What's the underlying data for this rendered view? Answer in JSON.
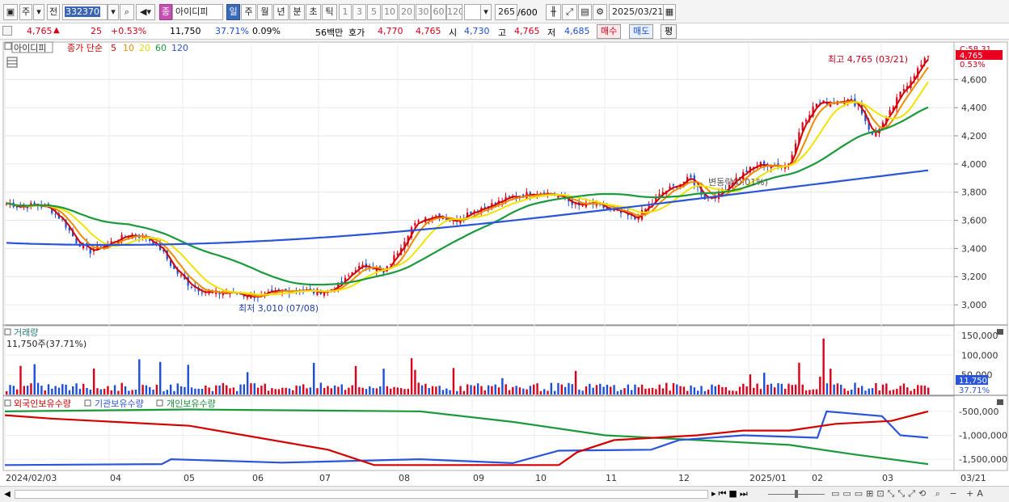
{
  "toolbar": {
    "type_label": "주",
    "prev_label": "전",
    "stock_code": "332370",
    "indicator_label": "종",
    "stock_name": "아이디피",
    "period_day": "일",
    "period_week": "주",
    "period_month": "월",
    "period_year": "년",
    "period_minute": "분",
    "period_second": "초",
    "period_tick": "틱",
    "intervals": [
      "1",
      "3",
      "5",
      "10",
      "20",
      "30",
      "60",
      "120"
    ],
    "count_value": "265",
    "count_total": "/600",
    "date": "2025/03/21"
  },
  "quote": {
    "price": "4,765",
    "change_arrow": "▲",
    "change": "25",
    "change_pct": "+0.53%",
    "volume": "11,750",
    "volume_ratio": "37.71%",
    "turnover": "0.09%",
    "amount": "56백만",
    "bid_label": "호가",
    "bid_1": "4,770",
    "bid_2": "4,765",
    "open_label": "시",
    "open": "4,730",
    "high_label": "고",
    "high": "4,765",
    "low_label": "저",
    "low": "4,685",
    "buy_label": "매수",
    "sell_label": "매도",
    "eval_label": "평"
  },
  "chart_legend": {
    "name_tag": "아이디피",
    "series_label": "종가 단순",
    "ma": [
      "5",
      "10",
      "20",
      "60",
      "120"
    ]
  },
  "annotations": {
    "high_note": "최고 4,765 (03/21)",
    "low_note": "최저 3,010 (07/08)",
    "mid_note": "변동락(0.01%)",
    "price_box": "4,765",
    "price_pct": "0.53%",
    "c_label": "C:58.31"
  },
  "volume_panel": {
    "title": "거래량",
    "current": "11,750주(37.71%)",
    "box_value": "11,750",
    "box_pct": "37.71%"
  },
  "holding_panel": {
    "legend": [
      "외국인보유수량",
      "기관보유수량",
      "개인보유수량"
    ]
  },
  "x_axis": [
    "2024/02/03",
    "04",
    "05",
    "06",
    "07",
    "08",
    "09",
    "10",
    "11",
    "12",
    "2025/01",
    "02",
    "03",
    "03/21"
  ],
  "colors": {
    "up": "#d8001a",
    "down": "#1d4fd6",
    "ma5": "#d40000",
    "ma10": "#f08c00",
    "ma20": "#f0e400",
    "ma60": "#1a9a3a",
    "ma120": "#2a55d8"
  },
  "chart_data": [
    {
      "type": "candlestick",
      "title": "아이디피",
      "y_ticks": [
        3000,
        3200,
        3400,
        3600,
        3800,
        4000,
        4200,
        4400,
        4600
      ],
      "ylim": [
        2880,
        4820
      ],
      "x_labels": [
        "2024/02",
        "03",
        "04",
        "05",
        "06",
        "07",
        "08",
        "09",
        "10",
        "11",
        "12",
        "2025/01",
        "02",
        "03"
      ],
      "close": [
        3720,
        3700,
        3710,
        3690,
        3600,
        3450,
        3380,
        3420,
        3470,
        3500,
        3480,
        3400,
        3250,
        3150,
        3100,
        3080,
        3090,
        3070,
        3060,
        3080,
        3100,
        3110,
        3090,
        3100,
        3150,
        3260,
        3280,
        3220,
        3380,
        3550,
        3620,
        3640,
        3590,
        3650,
        3690,
        3720,
        3760,
        3780,
        3800,
        3790,
        3750,
        3700,
        3720,
        3680,
        3650,
        3610,
        3700,
        3800,
        3850,
        3900,
        3760,
        3780,
        3880,
        3950,
        4000,
        3980,
        4000,
        4300,
        4430,
        4440,
        4460,
        4420,
        4200,
        4320,
        4500,
        4640,
        4765
      ],
      "ma60_end": 4175,
      "ma120_end": 3955,
      "low_marker": {
        "date": "07/08",
        "value": 3010
      },
      "high_marker": {
        "date": "03/21",
        "value": 4765
      }
    },
    {
      "type": "bar",
      "title": "거래량",
      "y_ticks": [
        50000,
        100000,
        150000
      ],
      "ylim": [
        0,
        160000
      ],
      "current": 11750
    },
    {
      "type": "line",
      "title": "보유수량",
      "series": [
        {
          "name": "외국인보유수량",
          "start": -580000,
          "end": -500000
        },
        {
          "name": "기관보유수량",
          "start": -1620000,
          "end": -1050000
        },
        {
          "name": "개인보유수량",
          "start": -500000,
          "end": -1600000
        }
      ],
      "y_ticks": [
        -500000,
        -1000000,
        -1500000
      ]
    }
  ]
}
